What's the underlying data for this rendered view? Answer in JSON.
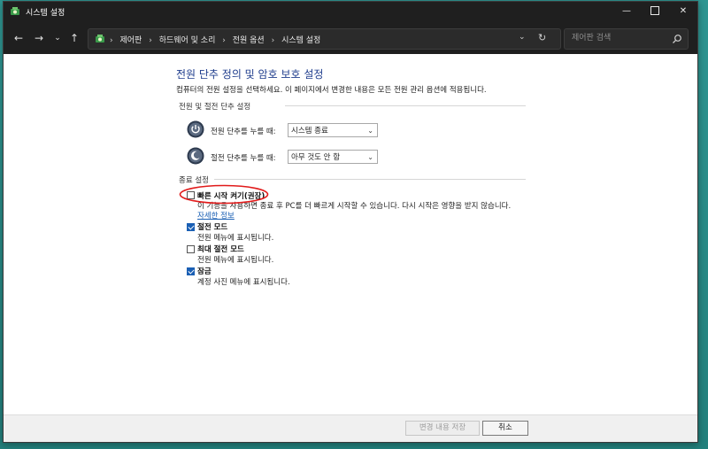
{
  "window": {
    "title": "시스템 설정",
    "app_icon": "power-options-icon"
  },
  "nav": {
    "back_icon": "arrow-left-icon",
    "forward_icon": "arrow-right-icon",
    "recent_icon": "chevron-down-icon",
    "up_icon": "arrow-up-icon",
    "breadcrumbs": [
      "제어판",
      "하드웨어 및 소리",
      "전원 옵션",
      "시스템 설정"
    ],
    "search_placeholder": "제어판 검색"
  },
  "page": {
    "title": "전원 단추 정의 및 암호 보호 설정",
    "description": "컴퓨터의 전원 설정을 선택하세요. 이 페이지에서 변경한 내용은 모든 전원 관리 옵션에 적용됩니다."
  },
  "power_buttons": {
    "header": "전원 및 절전 단추 설정",
    "rows": [
      {
        "label": "전원 단추를 누를 때:",
        "value": "시스템 종료",
        "icon": "power-button-icon"
      },
      {
        "label": "절전 단추를 누를 때:",
        "value": "아무 것도 안 함",
        "icon": "sleep-button-icon"
      }
    ]
  },
  "shutdown": {
    "header": "종료 설정",
    "options": [
      {
        "label": "빠른 시작 켜기(권장)",
        "checked": false,
        "description": "이 기능을 사용하면 종료 후 PC를 더 빠르게 시작할 수 있습니다. 다시 시작은 영향을 받지 않습니다.",
        "link": "자세한 정보"
      },
      {
        "label": "절전 모드",
        "checked": true,
        "description": "전원 메뉴에 표시됩니다."
      },
      {
        "label": "최대 절전 모드",
        "checked": false,
        "description": "전원 메뉴에 표시됩니다."
      },
      {
        "label": "잠금",
        "checked": true,
        "description": "계정 사진 메뉴에 표시됩니다."
      }
    ]
  },
  "footer": {
    "save_label": "변경 내용 저장",
    "cancel_label": "취소"
  },
  "colors": {
    "accent": "#1a5fb4",
    "title": "#1e3c8c",
    "annotation": "#e11b1b",
    "titlebar": "#1f1f1f"
  }
}
